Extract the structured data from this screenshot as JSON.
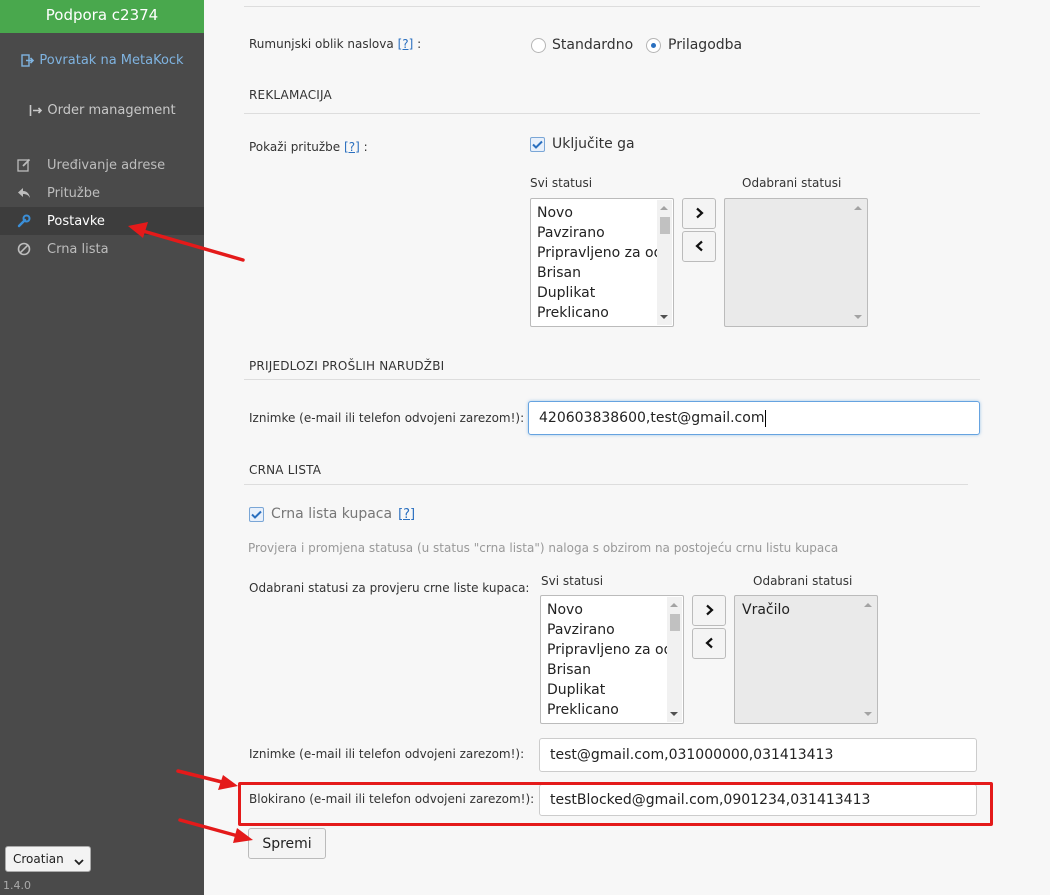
{
  "sidebar": {
    "header": "Podpora c2374",
    "back_link": "Povratak na MetaKock",
    "order_management": "Order management",
    "items": [
      {
        "label": "Uređivanje adrese",
        "icon": "edit-icon"
      },
      {
        "label": "Pritužbe",
        "icon": "reply-icon"
      },
      {
        "label": "Postavke",
        "icon": "wrench-icon",
        "active": true
      },
      {
        "label": "Crna lista",
        "icon": "ban-icon"
      }
    ],
    "language": "Croatian",
    "version": "1.4.0"
  },
  "address_format": {
    "label": "Rumunjski oblik naslova",
    "help": "[?]",
    "colon": ":",
    "options": [
      "Standardno",
      "Prilagodba"
    ],
    "selected": "Prilagodba"
  },
  "complaints": {
    "title": "REKLAMACIJA",
    "show_label": "Pokaži pritužbe",
    "help": "[?]",
    "colon": ":",
    "enable_label": "Uključite ga",
    "enabled": true,
    "all_statuses_label": "Svi statusi",
    "selected_statuses_label": "Odabrani statusi",
    "all_statuses": [
      "Novo",
      "Pavzirano",
      "Pripravljeno za od",
      "Brisan",
      "Duplikat",
      "Preklicano"
    ],
    "selected_statuses": []
  },
  "suggestions": {
    "title": "PRIJEDLOZI PROŠLIH NARUDŽBI",
    "exceptions_label": "Iznimke (e-mail ili telefon odvojeni zarezom!):",
    "exceptions_value": "420603838600,test@gmail.com"
  },
  "blacklist": {
    "title": "CRNA LISTA",
    "checkbox_label": "Crna lista kupaca",
    "help": "[?]",
    "enabled": true,
    "description": "Provjera i promjena statusa (u status \"crna lista\") naloga s obzirom na postojeću crnu listu kupaca",
    "statuses_label": "Odabrani statusi za provjeru crne liste kupaca:",
    "all_statuses_label": "Svi statusi",
    "selected_statuses_label": "Odabrani statusi",
    "all_statuses": [
      "Novo",
      "Pavzirano",
      "Pripravljeno za od",
      "Brisan",
      "Duplikat",
      "Preklicano"
    ],
    "selected_statuses": [
      "Vračilo"
    ],
    "exceptions_label": "Iznimke (e-mail ili telefon odvojeni zarezom!):",
    "exceptions_value": "test@gmail.com,031000000,031413413",
    "blocked_label": "Blokirano (e-mail ili telefon odvojeni zarezom!):",
    "blocked_value": "testBlocked@gmail.com,0901234,031413413"
  },
  "save_label": "Spremi",
  "colors": {
    "sidebar_bg": "#4a4a4a",
    "header_green": "#49a84d",
    "link_blue": "#2a6fbf",
    "annotation_red": "#e41a1a"
  }
}
